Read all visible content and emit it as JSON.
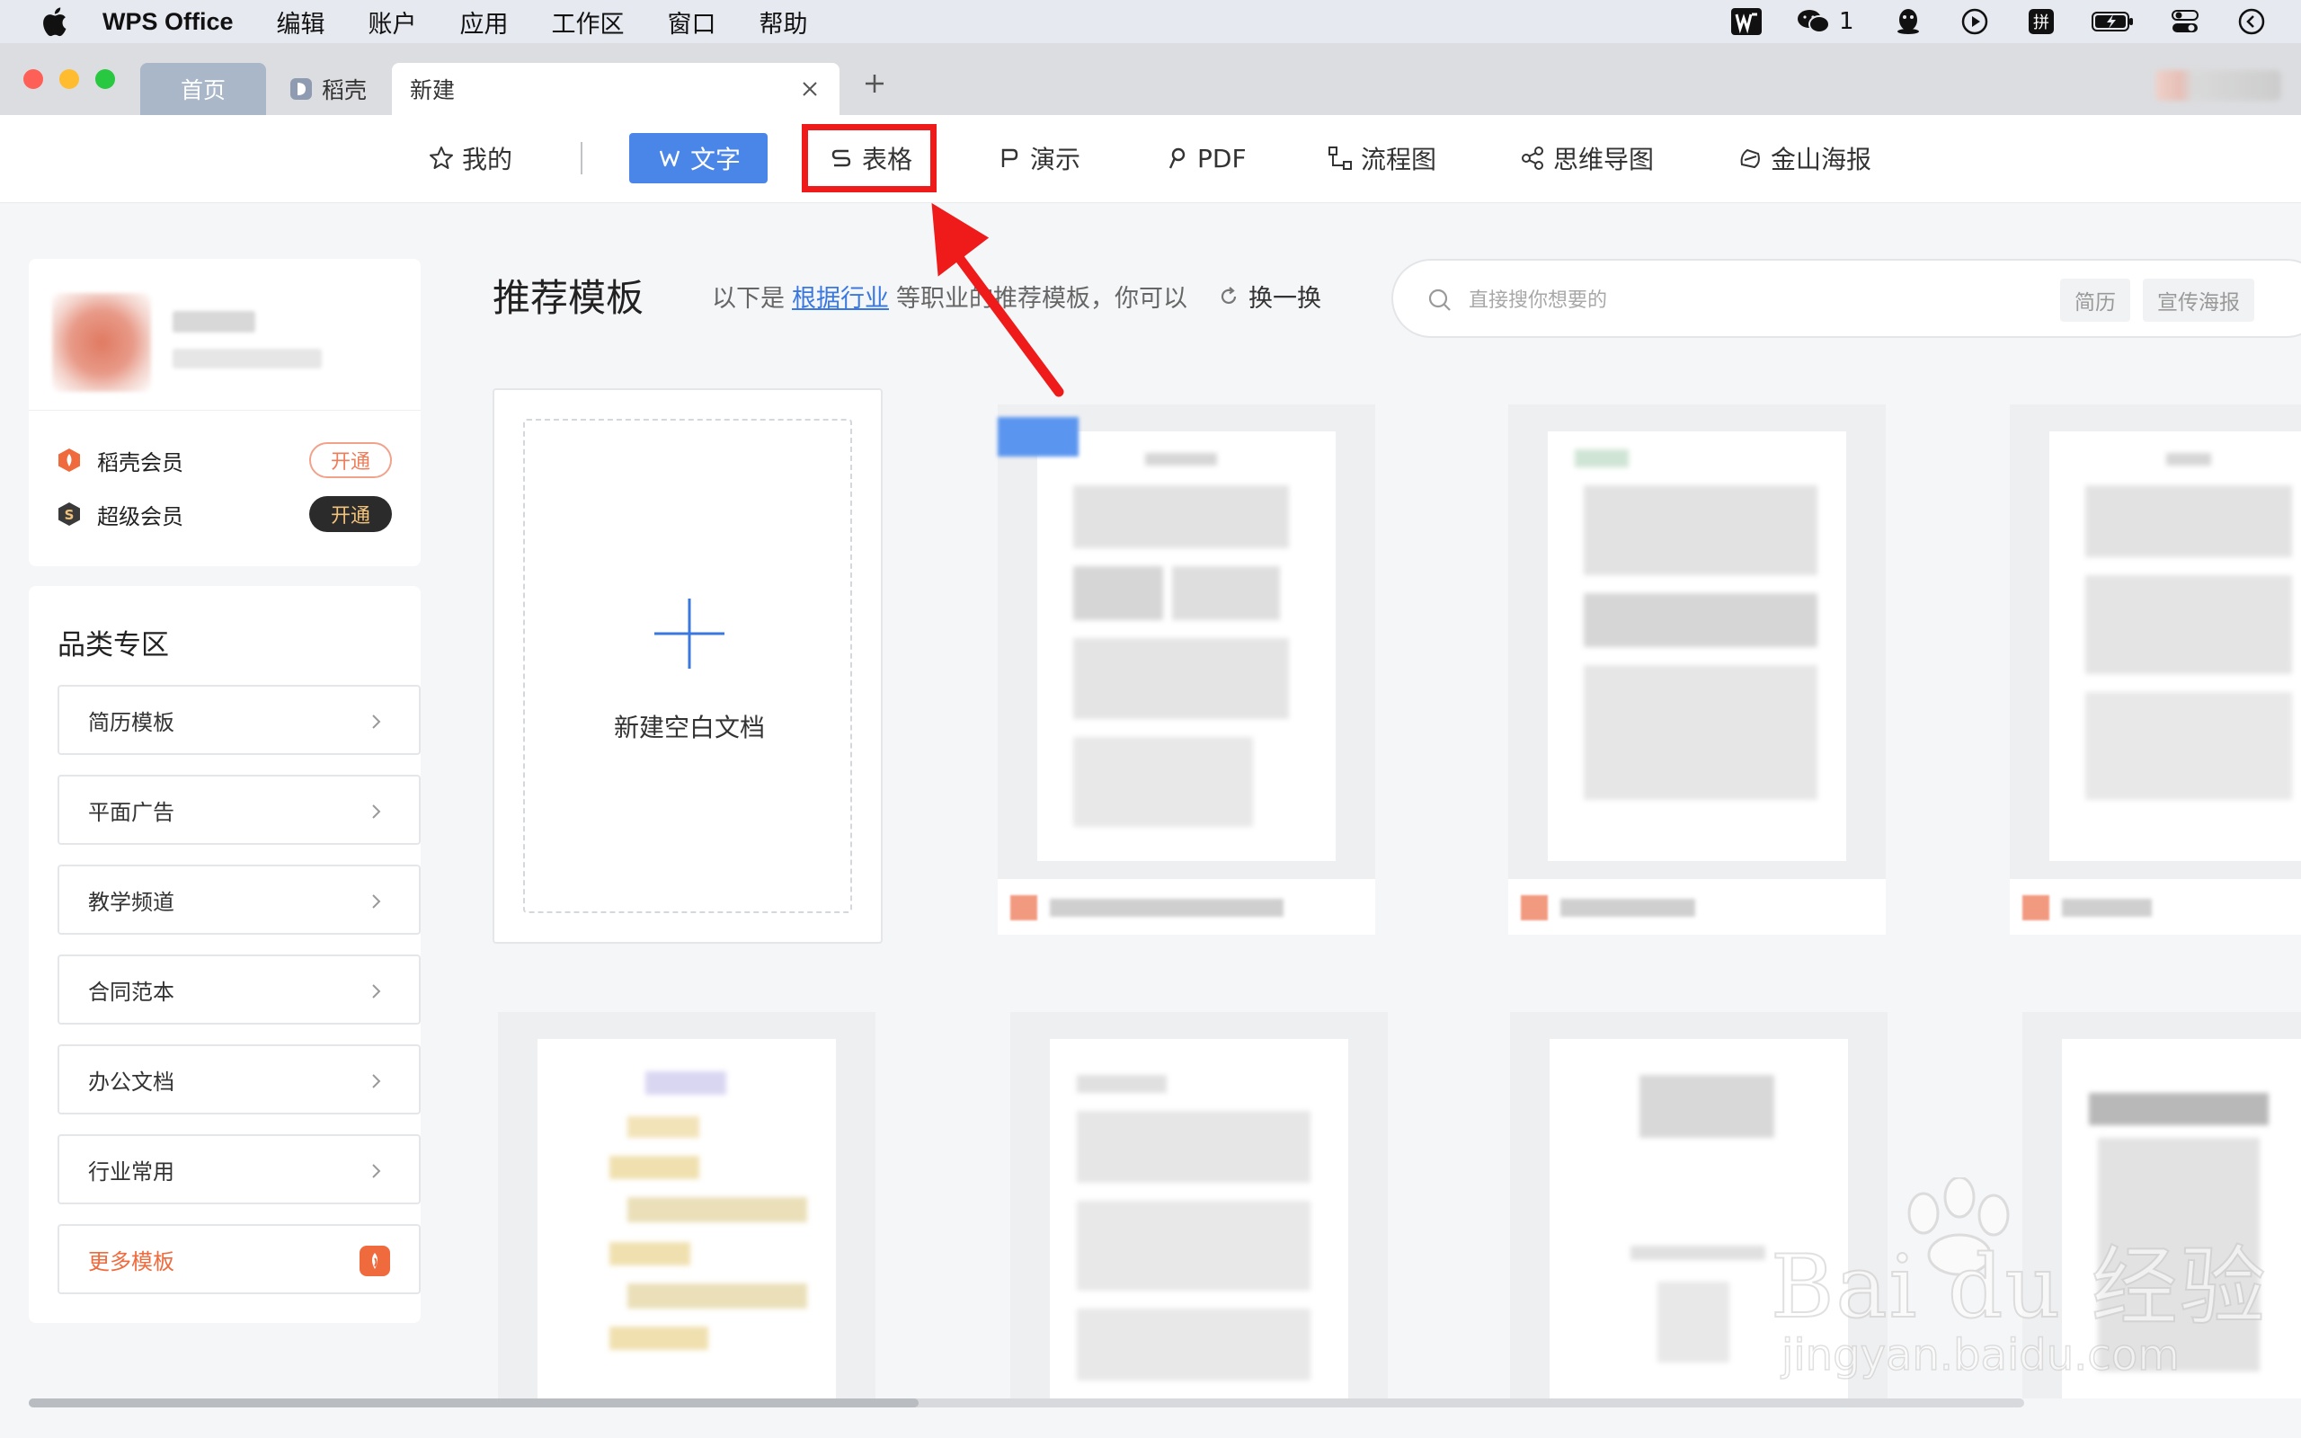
{
  "menubar": {
    "app_name": "WPS Office",
    "items": [
      "编辑",
      "账户",
      "应用",
      "工作区",
      "窗口",
      "帮助"
    ],
    "wechat_count": "1"
  },
  "tabs": {
    "home": "首页",
    "docer": "稻壳",
    "new": "新建"
  },
  "types": {
    "wode": "我的",
    "wenzi": "文字",
    "biaoge": "表格",
    "yanshi": "演示",
    "pdf": "PDF",
    "liucheng": "流程图",
    "siwei": "思维导图",
    "haibao": "金山海报"
  },
  "user": {
    "docer_member": "稻壳会员",
    "super_member": "超级会员",
    "open_label": "开通"
  },
  "category": {
    "title": "品类专区",
    "items": [
      "简历模板",
      "平面广告",
      "教学频道",
      "合同范本",
      "办公文档",
      "行业常用"
    ],
    "more": "更多模板"
  },
  "main": {
    "title": "推荐模板",
    "desc_prefix": "以下是",
    "desc_link": "根据行业",
    "desc_suffix": "等职业的推荐模板，你可以",
    "shuffle": "换一换",
    "new_blank": "新建空白文档"
  },
  "search": {
    "placeholder": "直接搜你想要的",
    "tags": [
      "简历",
      "宣传海报"
    ]
  },
  "watermark": {
    "main": "Bai du 经验",
    "sub": "jingyan.baidu.com"
  },
  "colors": {
    "accent": "#4a86e8",
    "highlight": "#ef1a1a",
    "docer_orange": "#ef6a3c"
  }
}
